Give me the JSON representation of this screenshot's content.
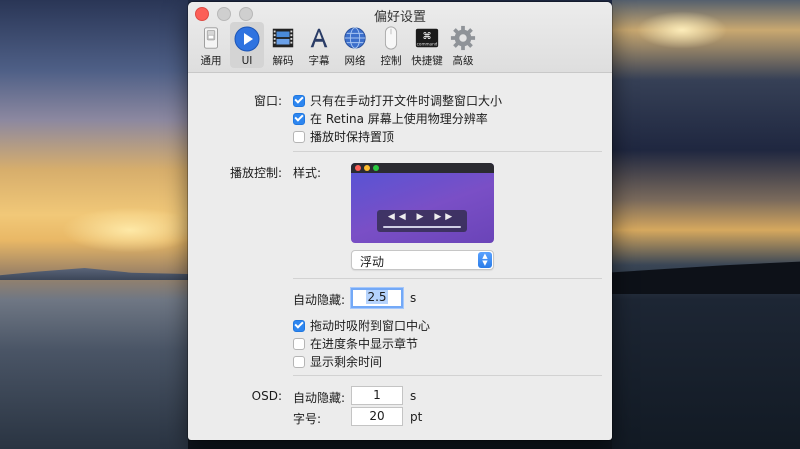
{
  "window": {
    "title": "偏好设置"
  },
  "toolbar": [
    {
      "id": "general",
      "label": "通用",
      "icon": "switch-icon"
    },
    {
      "id": "ui",
      "label": "UI",
      "icon": "play-icon",
      "selected": true
    },
    {
      "id": "codec",
      "label": "解码",
      "icon": "film-icon"
    },
    {
      "id": "subtitle",
      "label": "字幕",
      "icon": "letter-a-icon"
    },
    {
      "id": "network",
      "label": "网络",
      "icon": "globe-icon"
    },
    {
      "id": "control",
      "label": "控制",
      "icon": "mouse-icon"
    },
    {
      "id": "shortcut",
      "label": "快捷键",
      "icon": "command-key-icon",
      "key_text": "command"
    },
    {
      "id": "advanced",
      "label": "高级",
      "icon": "gear-icon"
    }
  ],
  "window_section": {
    "label": "窗口:",
    "options": [
      {
        "label": "只有在手动打开文件时调整窗口大小",
        "checked": true
      },
      {
        "label": "在 Retina 屏幕上使用物理分辨率",
        "checked": true
      },
      {
        "label": "播放时保持置顶",
        "checked": false
      }
    ]
  },
  "playback_section": {
    "label": "播放控制:",
    "style_label": "样式:",
    "style_selected": "浮动",
    "autohide_label": "自动隐藏:",
    "autohide_value": "2.5",
    "autohide_unit": "s",
    "options": [
      {
        "label": "拖动时吸附到窗口中心",
        "checked": true
      },
      {
        "label": "在进度条中显示章节",
        "checked": false
      },
      {
        "label": "显示剩余时间",
        "checked": false
      }
    ]
  },
  "osd_section": {
    "label": "OSD:",
    "autohide_label": "自动隐藏:",
    "autohide_value": "1",
    "autohide_unit": "s",
    "fontsize_label": "字号:",
    "fontsize_value": "20",
    "fontsize_unit": "pt"
  },
  "colors": {
    "accent": "#2d86f0",
    "close": "#fc5f57"
  }
}
